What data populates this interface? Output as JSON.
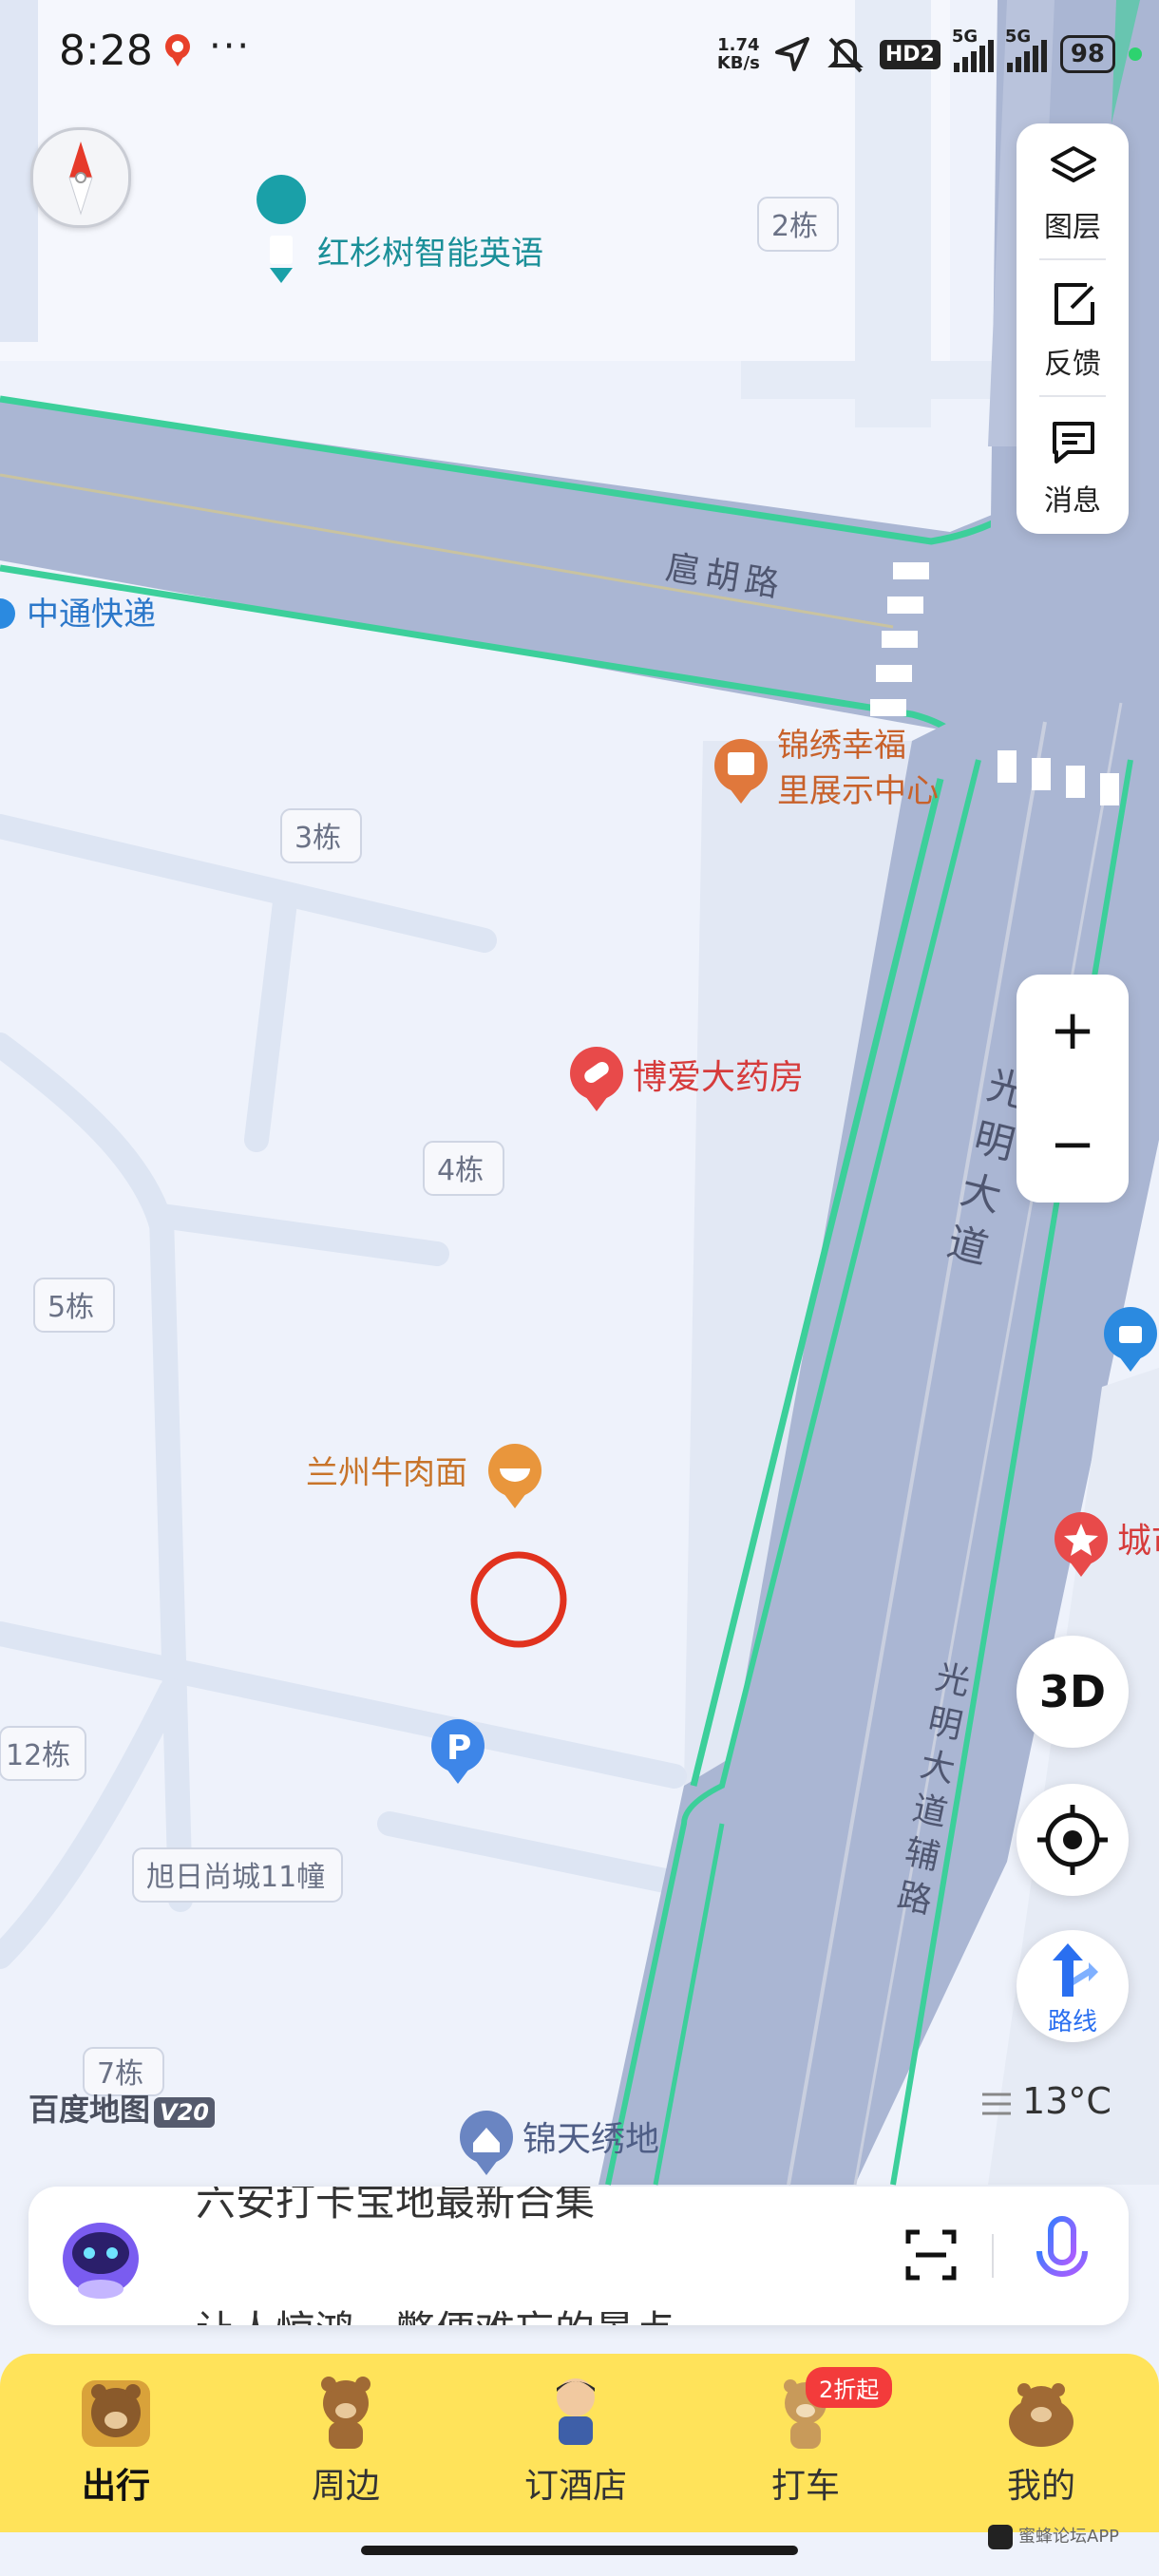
{
  "status_bar": {
    "time": "8:28",
    "more": "···",
    "net_speed_top": "1.74",
    "net_speed_bottom": "KB/s",
    "hd": "HD2",
    "five_g_1": "5G",
    "five_g_2": "5G",
    "battery": "98"
  },
  "map": {
    "roads": {
      "hutong_road": "扈胡路",
      "guangming_avenue": "光明大道",
      "guangming_aux": "光明大道辅路"
    },
    "pois": {
      "hongshanshu": "红杉树智能英语",
      "zhongtong": "中通快递",
      "jinxiu": "锦绣幸福里展示中心",
      "boai": "博爱大药房",
      "lanzhou": "兰州牛肉面",
      "jintian": "锦天绣地",
      "city_partial": "城市"
    },
    "buildings": {
      "b2": "2栋",
      "b3": "3栋",
      "b4": "4栋",
      "b5": "5栋",
      "b7": "7栋",
      "b12": "12栋",
      "b11": "旭日尚城11幢"
    }
  },
  "side_panel": {
    "layers": "图层",
    "feedback": "反馈",
    "messages": "消息"
  },
  "zoom": {
    "in": "+",
    "out": "−"
  },
  "btn_3d": "3D",
  "route": "路线",
  "logo": {
    "name": "百度地图",
    "version": "V20"
  },
  "weather": "13°C",
  "search": {
    "line1": "六安打卡宝地最新合集",
    "line2": "让人惊鸿一瞥便难忘的景点"
  },
  "tabs": [
    {
      "label": "出行"
    },
    {
      "label": "周边"
    },
    {
      "label": "订酒店"
    },
    {
      "label": "打车"
    },
    {
      "label": "我的"
    }
  ],
  "promo_badge": "2折起",
  "watermark": "蜜蜂论坛APP",
  "colors": {
    "map_bg": "#eef2fb",
    "road": "#aab6d3",
    "road_edge": "#3ccf9a",
    "tab_bar": "#ffe35a",
    "poi_orange": "#e0783c",
    "poi_red": "#e84a4a",
    "poi_blue": "#2b8ae0",
    "poi_teal": "#1aa0a8",
    "target_ring": "#e1321e"
  }
}
